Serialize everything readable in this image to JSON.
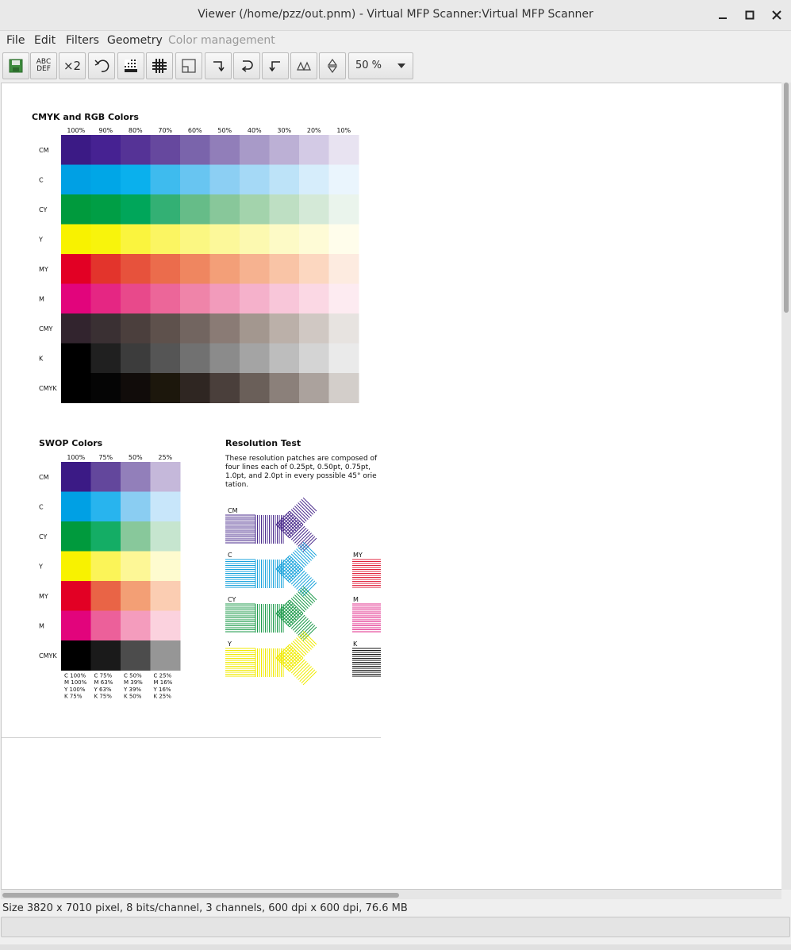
{
  "window": {
    "title": "Viewer (/home/pzz/out.pnm) - Virtual MFP Scanner:Virtual MFP Scanner",
    "controls": [
      "minimize",
      "maximize",
      "close"
    ]
  },
  "menu": [
    "File",
    "Edit",
    "Filters",
    "Geometry",
    "Color management"
  ],
  "toolbar": {
    "abc_label_1": "ABC",
    "abc_label_2": "DEF",
    "x2_label": "×2",
    "zoom_value": "50 %"
  },
  "document": {
    "cmyk_title": "CMYK and RGB Colors",
    "percent_headers": [
      "100%",
      "90%",
      "80%",
      "70%",
      "60%",
      "50%",
      "40%",
      "30%",
      "20%",
      "10%"
    ],
    "cmyk_rows": [
      {
        "label": "CM",
        "colors": [
          "#3b1a85",
          "#462292",
          "#553396",
          "#66489e",
          "#7a64ab",
          "#917eb9",
          "#a89ac8",
          "#bcb0d5",
          "#d3cae5",
          "#e8e3f1"
        ]
      },
      {
        "label": "C",
        "colors": [
          "#00a0e4",
          "#00a6e7",
          "#0ab0ed",
          "#3ebbee",
          "#68c5f1",
          "#8ccff3",
          "#a5d9f6",
          "#bde3f8",
          "#d6edfb",
          "#eaf5fd"
        ]
      },
      {
        "label": "CY",
        "colors": [
          "#009a3d",
          "#009e45",
          "#00a65a",
          "#33b074",
          "#66bc88",
          "#88c79a",
          "#a3d3ac",
          "#bedfc3",
          "#d4e9d7",
          "#eaf4ec"
        ]
      },
      {
        "label": "Y",
        "colors": [
          "#f8f200",
          "#f8f40c",
          "#faf43e",
          "#fbf562",
          "#fbf782",
          "#fcf89a",
          "#fcf9b0",
          "#fdfac6",
          "#fefbd6",
          "#fffdeb"
        ]
      },
      {
        "label": "MY",
        "colors": [
          "#e20024",
          "#e3342c",
          "#e7523c",
          "#eb6c4c",
          "#ef8660",
          "#f39f78",
          "#f6b290",
          "#f9c4a6",
          "#fcd7c0",
          "#fdebe0"
        ]
      },
      {
        "label": "M",
        "colors": [
          "#e2047c",
          "#e52683",
          "#e8498b",
          "#ec6699",
          "#ef84a9",
          "#f29bbb",
          "#f5b1cb",
          "#f8c6d9",
          "#fbd8e4",
          "#fdebf1"
        ]
      },
      {
        "label": "CMY",
        "colors": [
          "#32242e",
          "#3a3033",
          "#4b3f3d",
          "#5e514c",
          "#726560",
          "#8a7b75",
          "#a3978f",
          "#bbb0a9",
          "#d0c8c3",
          "#e7e3e0"
        ]
      },
      {
        "label": "K",
        "colors": [
          "#000000",
          "#202020",
          "#3c3c3c",
          "#555555",
          "#717171",
          "#8b8b8b",
          "#a4a4a4",
          "#bdbdbd",
          "#d4d4d4",
          "#eaeaea"
        ]
      },
      {
        "label": "CMYK",
        "colors": [
          "#000000",
          "#050505",
          "#110c0a",
          "#1c170c",
          "#2f2622",
          "#4a3f3b",
          "#6a5f59",
          "#8b807a",
          "#aba29d",
          "#d3ceca"
        ]
      }
    ],
    "swop_title": "SWOP Colors",
    "swop_headers": [
      "100%",
      "75%",
      "50%",
      "25%"
    ],
    "swop_rows": [
      {
        "label": "CM",
        "colors": [
          "#3b1a85",
          "#63479c",
          "#927fba",
          "#c5b8da"
        ]
      },
      {
        "label": "C",
        "colors": [
          "#00a0e4",
          "#28b4ee",
          "#8acdf2",
          "#c8e6fa"
        ]
      },
      {
        "label": "CY",
        "colors": [
          "#009a3d",
          "#14ad65",
          "#88c89b",
          "#c6e5cf"
        ]
      },
      {
        "label": "Y",
        "colors": [
          "#f8f200",
          "#fbf458",
          "#fdf796",
          "#fefbcf"
        ]
      },
      {
        "label": "MY",
        "colors": [
          "#e20024",
          "#e96446",
          "#f39f75",
          "#fbcdb2"
        ]
      },
      {
        "label": "M",
        "colors": [
          "#e2047c",
          "#ec609a",
          "#f49cbd",
          "#fbd2de"
        ]
      },
      {
        "label": "CMYK",
        "colors": [
          "#000000",
          "#1a1a1a",
          "#4c4c4c",
          "#969696"
        ]
      }
    ],
    "swop_footnotes": [
      [
        "C 100%",
        "M 100%",
        "Y  100%",
        "K 75%"
      ],
      [
        "C 75%",
        "M 63%",
        "Y  63%",
        "K 75%"
      ],
      [
        "C 50%",
        "M 39%",
        "Y  39%",
        "K 50%"
      ],
      [
        "C 25%",
        "M 16%",
        "Y  16%",
        "K 25%"
      ]
    ],
    "resolution_title": "Resolution Test",
    "resolution_text": [
      "These resolution patches are composed of",
      "four lines each of 0.25pt, 0.50pt, 0.75pt,",
      "1.0pt, and 2.0pt in every possible 45° orie",
      "tation."
    ],
    "resolution_patches": [
      {
        "label": "CM",
        "color": "#4a2b8c"
      },
      {
        "label": "C",
        "color": "#1aa3dc"
      },
      {
        "label": "CY",
        "color": "#1b9a4a"
      },
      {
        "label": "Y",
        "color": "#f0ea00"
      },
      {
        "label": "MY",
        "color": "#e0233e"
      },
      {
        "label": "M",
        "color": "#e2288a"
      },
      {
        "label": "K",
        "color": "#111111"
      }
    ]
  },
  "status": "Size 3820 x 7010 pixel, 8 bits/channel, 3 channels, 600 dpi x 600 dpi, 76.6 MB"
}
